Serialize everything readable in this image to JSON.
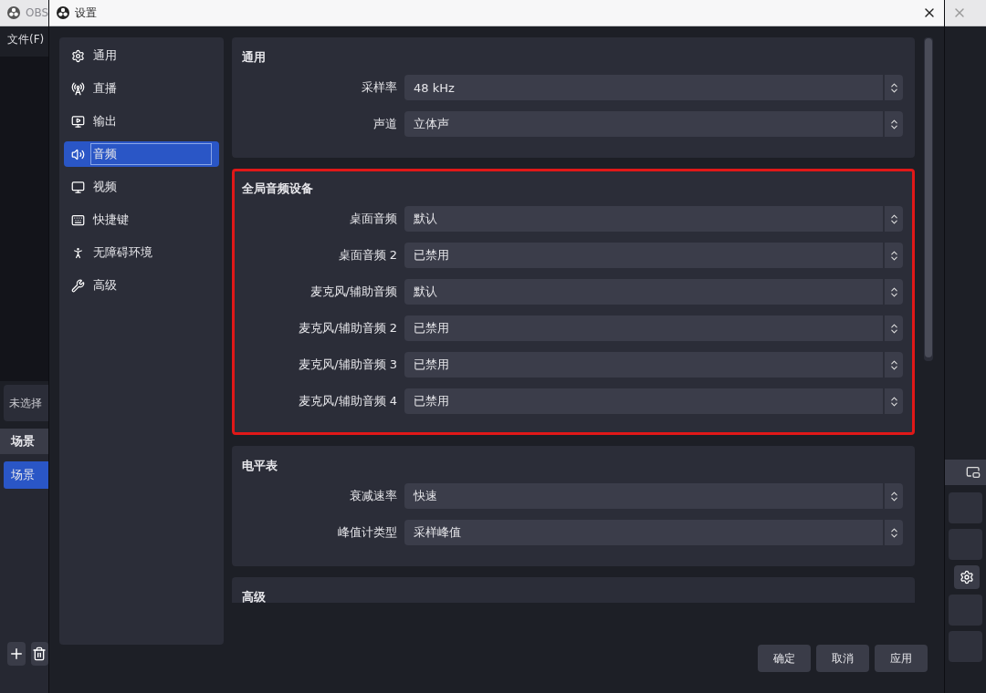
{
  "main_window": {
    "title": "OBS",
    "menu": "文件(F)",
    "source_panel": "未选择",
    "scenes_header": "场景",
    "scenes": [
      {
        "label": "场景",
        "selected": true
      }
    ]
  },
  "dialog": {
    "title": "设置",
    "sidebar": [
      {
        "label": "通用",
        "selected": false
      },
      {
        "label": "直播",
        "selected": false
      },
      {
        "label": "输出",
        "selected": false
      },
      {
        "label": "音频",
        "selected": true
      },
      {
        "label": "视频",
        "selected": false
      },
      {
        "label": "快捷键",
        "selected": false
      },
      {
        "label": "无障碍环境",
        "selected": false
      },
      {
        "label": "高级",
        "selected": false
      }
    ],
    "sections": [
      {
        "title": "通用",
        "highlighted": false,
        "rows": [
          {
            "label": "采样率",
            "value": "48 kHz"
          },
          {
            "label": "声道",
            "value": "立体声"
          }
        ]
      },
      {
        "title": "全局音频设备",
        "highlighted": true,
        "rows": [
          {
            "label": "桌面音频",
            "value": "默认"
          },
          {
            "label": "桌面音频 2",
            "value": "已禁用"
          },
          {
            "label": "麦克风/辅助音频",
            "value": "默认"
          },
          {
            "label": "麦克风/辅助音频 2",
            "value": "已禁用"
          },
          {
            "label": "麦克风/辅助音频 3",
            "value": "已禁用"
          },
          {
            "label": "麦克风/辅助音频 4",
            "value": "已禁用"
          }
        ]
      },
      {
        "title": "电平表",
        "highlighted": false,
        "rows": [
          {
            "label": "衰减速率",
            "value": "快速"
          },
          {
            "label": "峰值计类型",
            "value": "采样峰值"
          }
        ]
      },
      {
        "title": "高级",
        "highlighted": false
      }
    ],
    "buttons": [
      "确定",
      "取消",
      "应用"
    ]
  }
}
